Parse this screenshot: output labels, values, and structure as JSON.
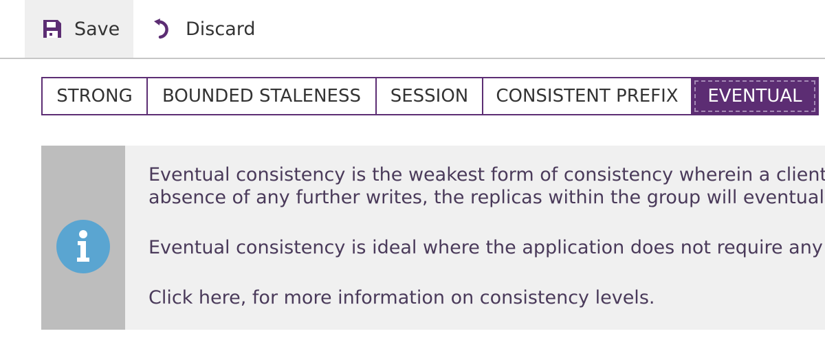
{
  "toolbar": {
    "save_label": "Save",
    "discard_label": "Discard",
    "save_icon": "save-icon",
    "discard_icon": "undo-icon"
  },
  "tabs": [
    {
      "label": "STRONG",
      "selected": false
    },
    {
      "label": "BOUNDED STALENESS",
      "selected": false
    },
    {
      "label": "SESSION",
      "selected": false
    },
    {
      "label": "CONSISTENT PREFIX",
      "selected": false
    },
    {
      "label": "EVENTUAL",
      "selected": true
    }
  ],
  "info": {
    "icon": "info-icon",
    "line1": "Eventual consistency is the weakest form of consistency wherein a client may",
    "line2": "absence of any further writes, the replicas within the group will eventually co",
    "paragraph2": "Eventual consistency is ideal where the application does not require any orde",
    "link_text": "Click here, for more information on consistency levels."
  },
  "colors": {
    "accent": "#5c2d73",
    "info_panel": "#f0f0f0",
    "info_side": "#bdbdbd",
    "info_icon": "#5aa5d1"
  }
}
